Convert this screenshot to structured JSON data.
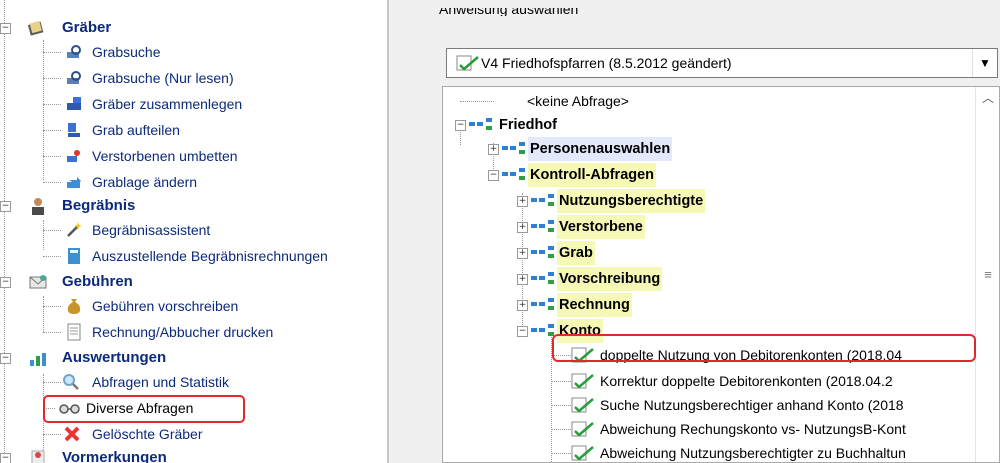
{
  "nav": {
    "groups": [
      {
        "label": "Gräber",
        "items": [
          "Grabsuche",
          "Grabsuche (Nur lesen)",
          "Gräber zusammenlegen",
          "Grab aufteilen",
          "Verstorbenen umbetten",
          "Grablage ändern"
        ]
      },
      {
        "label": "Begräbnis",
        "items": [
          "Begräbnisassistent",
          "Auszustellende Begräbnisrechnungen"
        ]
      },
      {
        "label": "Gebühren",
        "items": [
          "Gebühren vorschreiben",
          "Rechnung/Abbucher drucken"
        ]
      },
      {
        "label": "Auswertungen",
        "items": [
          "Abfragen und Statistik",
          "Diverse Abfragen",
          "Gelöschte Gräber"
        ]
      },
      {
        "label": "Vormerkungen",
        "items": []
      }
    ]
  },
  "right": {
    "section_label": "Anweisung auswählen",
    "combo_value": "V4 Friedhofspfarren (8.5.2012 geändert)",
    "tree": {
      "none_option": "<keine Abfrage>",
      "root": "Friedhof",
      "personenauswahlen": "Personenauswahlen",
      "kontroll": "Kontroll-Abfragen",
      "folders": [
        "Nutzungsberechtigte",
        "Verstorbene",
        "Grab",
        "Vorschreibung",
        "Rechnung",
        "Konto"
      ],
      "konto_items": [
        "doppelte Nutzung von Debitorenkonten (2018.04",
        "Korrektur doppelte Debitorenkonten  (2018.04.2",
        "Suche Nutzungsberechtiger anhand Konto (2018",
        "Abweichung Rechungskonto vs- NutzungsB-Kont",
        "Abweichung Nutzungsberechtigter zu Buchhaltun"
      ]
    }
  },
  "colors": {
    "highlight_border": "#e0282f",
    "nav_text": "#0b2a7a",
    "blue_highlight": "#e4e8fb",
    "yellow_highlight": "#f6f8b6"
  },
  "icons": {
    "expanders": "minus-box / plus-box",
    "nav": [
      "book-icon",
      "search-grave-icon",
      "merge-icon",
      "split-icon",
      "rebury-icon",
      "relocate-icon",
      "person-icon",
      "wand-icon",
      "calculator-icon",
      "envelope-icon",
      "money-bag-icon",
      "document-icon",
      "chart-icon",
      "magnifier-icon",
      "glasses-icon",
      "red-x-icon",
      "pin-icon"
    ],
    "tree": [
      "query-icon",
      "folder-tree-icon"
    ]
  }
}
